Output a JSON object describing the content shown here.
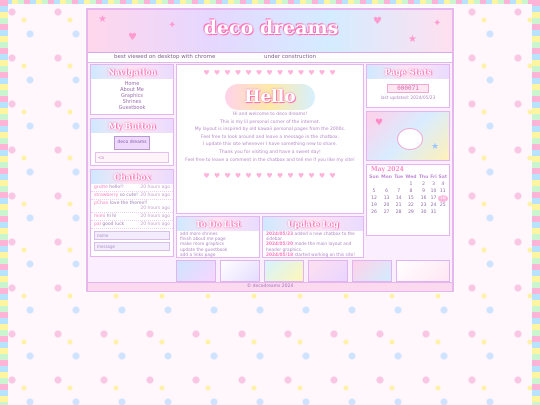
{
  "header": {
    "title": "deco dreams",
    "best_viewed": "best viewed on desktop with chrome",
    "construction": "under construction"
  },
  "nav": {
    "title": "Navigation",
    "items": [
      "Home",
      "About Me",
      "Graphics",
      "Shrines",
      "Guestbook"
    ]
  },
  "my_button": {
    "title": "My Button",
    "button_text": "deco dreams",
    "code": "<a href=\"decodreams.neocities.org\"><img src=\"button.gif\"></a>"
  },
  "chat": {
    "title": "Chatbox",
    "messages": [
      {
        "name": "grutte",
        "text": "hello!!",
        "time": "20 hours ago"
      },
      {
        "name": "strawberry",
        "text": "so cute!",
        "time": "20 hours ago"
      },
      {
        "name": "pChan",
        "text": "love the theme!!",
        "time": "20 hours ago"
      },
      {
        "name": "mimi",
        "text": "hi hi",
        "time": "20 hours ago"
      },
      {
        "name": "pal",
        "text": "good luck",
        "time": "20 hours ago"
      }
    ],
    "input_name": "name",
    "input_msg": "message"
  },
  "main": {
    "hello": "Hello",
    "intro": [
      "Hi and welcome to deco dreams!",
      "This is my lil personal corner of the internet.",
      "My layout is inspired by old kawaii personal pages from the 2000s.",
      "Feel free to look around and leave a message in the chatbox.",
      "I update this site whenever I have something new to share.",
      "Thank you for visiting and have a sweet day!",
      "Feel free to leave a comment in the chatbox and tell me if you like my site!"
    ]
  },
  "todo": {
    "title": "To Do List",
    "items": [
      "add more shrines",
      "finish about me page",
      "make more graphics",
      "update the guestbook",
      "add a links page"
    ]
  },
  "updates": {
    "title": "Update Log",
    "entries": [
      {
        "date": "2024/05/23",
        "text": "added a new chatbox to the sidebar."
      },
      {
        "date": "2024/05/20",
        "text": "made the main layout and header graphics."
      },
      {
        "date": "2024/05/18",
        "text": "started working on this site!"
      }
    ]
  },
  "page_stats": {
    "title": "Page Stats",
    "counter": "000071",
    "updated": "last updated: 2024/05/23"
  },
  "calendar": {
    "month": "May 2024",
    "days": [
      "Sun",
      "Mon",
      "Tue",
      "Wed",
      "Thu",
      "Fri",
      "Sat"
    ],
    "weeks": [
      [
        "",
        "",
        "",
        "1",
        "2",
        "3",
        "4"
      ],
      [
        "5",
        "6",
        "7",
        "8",
        "9",
        "10",
        "11"
      ],
      [
        "12",
        "13",
        "14",
        "15",
        "16",
        "17",
        "18"
      ],
      [
        "19",
        "20",
        "21",
        "22",
        "23",
        "24",
        "25"
      ],
      [
        "26",
        "27",
        "28",
        "29",
        "30",
        "31",
        ""
      ]
    ],
    "today": "18"
  },
  "footer": {
    "text": "© decodreams 2024"
  },
  "colors": {
    "pink": "#ff7cbf",
    "lavender": "#e4b5ee",
    "background": "#fff7fc"
  }
}
